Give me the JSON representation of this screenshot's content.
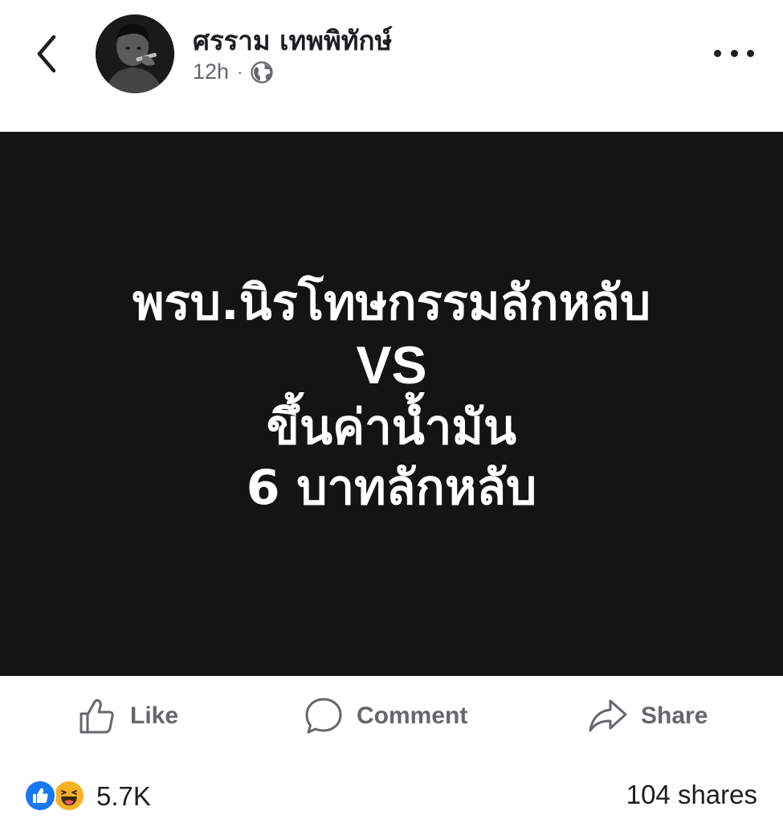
{
  "header": {
    "back_icon": "chevron-left-icon",
    "author_name": "ศรราม เทพพิทักษ์",
    "time_ago": "12h",
    "separator": "·",
    "privacy_icon": "globe-icon",
    "more_icon": "more-dots-icon"
  },
  "post": {
    "background_color": "#141414",
    "text_color": "#ffffff",
    "lines": [
      "พรบ.นิรโทษกรรมลักหลับ",
      "VS",
      "ขึ้นค่าน้ำมัน",
      "6 บาทลักหลับ"
    ]
  },
  "actions": {
    "like_label": "Like",
    "like_icon": "thumbs-up-icon",
    "comment_label": "Comment",
    "comment_icon": "speech-bubble-icon",
    "share_label": "Share",
    "share_icon": "share-arrow-icon"
  },
  "stats": {
    "reaction_icons": [
      "like-reaction-icon",
      "haha-reaction-icon"
    ],
    "reaction_count": "5.7K",
    "shares_count": "104 shares"
  },
  "colors": {
    "muted_text": "#65676b",
    "primary_text": "#1c1e21",
    "like_blue": "#1877f2",
    "haha_yellow": "#f7b125"
  }
}
